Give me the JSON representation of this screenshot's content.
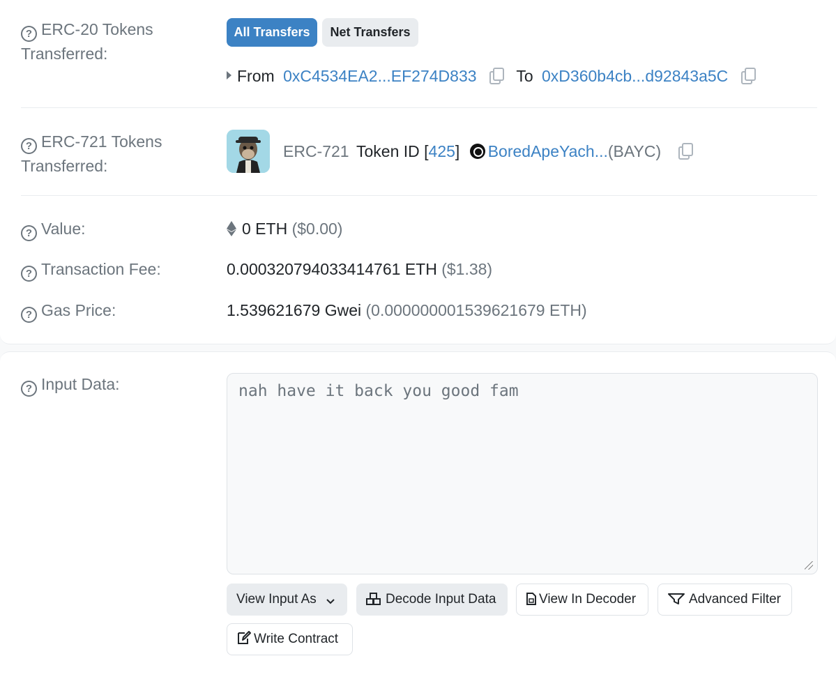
{
  "erc20": {
    "label": "ERC-20 Tokens Transferred:",
    "tabs": [
      "All Transfers",
      "Net Transfers"
    ],
    "from_label": "From",
    "from_address": "0xC4534EA2...EF274D833",
    "to_label": "To",
    "to_address": "0xD360b4cb...d92843a5C"
  },
  "erc721": {
    "label": "ERC-721 Tokens Transferred:",
    "standard": "ERC-721",
    "token_id_label": "Token ID [",
    "token_id": "425",
    "token_id_close": "]",
    "collection": "BoredApeYach...",
    "symbol": "(BAYC)"
  },
  "value": {
    "label": "Value:",
    "amount": "0 ETH",
    "usd": "($0.00)"
  },
  "fee": {
    "label": "Transaction Fee:",
    "amount": "0.000320794033414761 ETH",
    "usd": "($1.38)"
  },
  "gas": {
    "label": "Gas Price:",
    "amount": "1.539621679 Gwei",
    "eth": "(0.000000001539621679 ETH)"
  },
  "input": {
    "label": "Input Data:",
    "text": "nah have it back you good fam"
  },
  "buttons": {
    "view_input_as": "View Input As",
    "decode": "Decode Input Data",
    "view_in_decoder": "View In Decoder",
    "advanced_filter": "Advanced Filter",
    "write_contract": "Write Contract"
  },
  "colors": {
    "link": "#3c82c4",
    "muted": "#6c757d",
    "active_pill": "#3c82c4"
  }
}
